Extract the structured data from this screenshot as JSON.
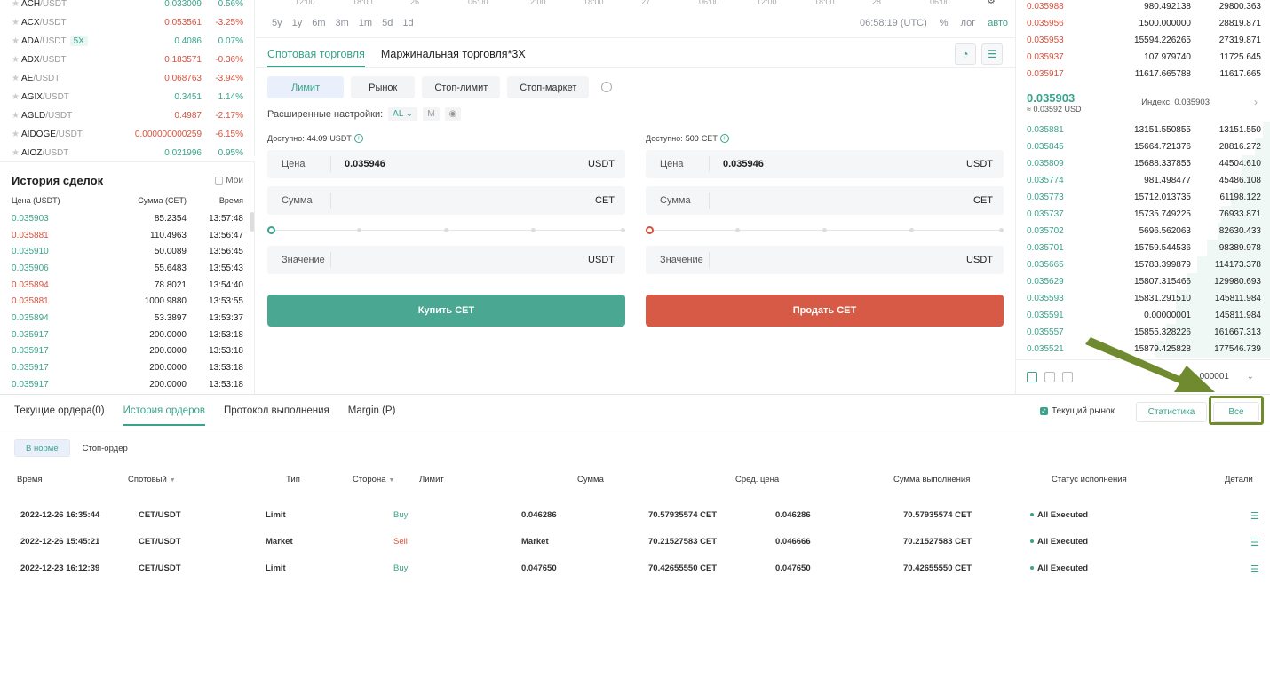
{
  "markets": [
    {
      "base": "ACH",
      "quote": "/USDT",
      "price": "0.033009",
      "change": "0.56%",
      "dir": "up",
      "lev": ""
    },
    {
      "base": "ACX",
      "quote": "/USDT",
      "price": "0.053561",
      "change": "-3.25%",
      "dir": "down",
      "lev": ""
    },
    {
      "base": "ADA",
      "quote": "/USDT",
      "price": "0.4086",
      "change": "0.07%",
      "dir": "up",
      "lev": "5X"
    },
    {
      "base": "ADX",
      "quote": "/USDT",
      "price": "0.183571",
      "change": "-0.36%",
      "dir": "down",
      "lev": ""
    },
    {
      "base": "AE",
      "quote": "/USDT",
      "price": "0.068763",
      "change": "-3.94%",
      "dir": "down",
      "lev": ""
    },
    {
      "base": "AGIX",
      "quote": "/USDT",
      "price": "0.3451",
      "change": "1.14%",
      "dir": "up",
      "lev": ""
    },
    {
      "base": "AGLD",
      "quote": "/USDT",
      "price": "0.4987",
      "change": "-2.17%",
      "dir": "down",
      "lev": ""
    },
    {
      "base": "AIDOGE",
      "quote": "/USDT",
      "price": "0.000000000259",
      "change": "-6.15%",
      "dir": "down",
      "lev": ""
    },
    {
      "base": "AIOZ",
      "quote": "/USDT",
      "price": "0.021996",
      "change": "0.95%",
      "dir": "up",
      "lev": ""
    }
  ],
  "trade_history": {
    "title": "История сделок",
    "mine_label": "Мои",
    "col_price": "Цена (USDT)",
    "col_amount": "Сумма (CET)",
    "col_time": "Время",
    "rows": [
      {
        "price": "0.035903",
        "amount": "85.2354",
        "time": "13:57:48",
        "dir": "up"
      },
      {
        "price": "0.035881",
        "amount": "110.4963",
        "time": "13:56:47",
        "dir": "down"
      },
      {
        "price": "0.035910",
        "amount": "50.0089",
        "time": "13:56:45",
        "dir": "up"
      },
      {
        "price": "0.035906",
        "amount": "55.6483",
        "time": "13:55:43",
        "dir": "up"
      },
      {
        "price": "0.035894",
        "amount": "78.8021",
        "time": "13:54:40",
        "dir": "down"
      },
      {
        "price": "0.035881",
        "amount": "1000.9880",
        "time": "13:53:55",
        "dir": "down"
      },
      {
        "price": "0.035894",
        "amount": "53.3897",
        "time": "13:53:37",
        "dir": "up"
      },
      {
        "price": "0.035917",
        "amount": "200.0000",
        "time": "13:53:18",
        "dir": "up"
      },
      {
        "price": "0.035917",
        "amount": "200.0000",
        "time": "13:53:18",
        "dir": "up"
      },
      {
        "price": "0.035917",
        "amount": "200.0000",
        "time": "13:53:18",
        "dir": "up"
      },
      {
        "price": "0.035917",
        "amount": "200.0000",
        "time": "13:53:18",
        "dir": "up"
      }
    ]
  },
  "chart": {
    "axis_labels": [
      "12:00",
      "18:00",
      "26",
      "06:00",
      "12:00",
      "18:00",
      "27",
      "06:00",
      "12:00",
      "18:00",
      "28",
      "06:00"
    ],
    "timeframes": [
      "5y",
      "1y",
      "6m",
      "3m",
      "1m",
      "5d",
      "1d"
    ],
    "clock": "06:58:19 (UTC)",
    "percent": "%",
    "log": "лог",
    "auto": "авто"
  },
  "trade": {
    "tab_spot": "Спотовая торговля",
    "tab_margin": "Маржинальная торговля*3X",
    "order_types": [
      "Лимит",
      "Рынок",
      "Стоп-лимит",
      "Стоп-маркет"
    ],
    "advanced_label": "Расширенные настройки:",
    "adv_opt1": "AL",
    "adv_opt2": "M",
    "buy": {
      "available_label": "Доступно:",
      "available_value": "44.09",
      "available_unit": "USDT",
      "price_label": "Цена",
      "price_value": "0.035946",
      "price_unit": "USDT",
      "amount_label": "Сумма",
      "amount_unit": "CET",
      "total_label": "Значение",
      "total_unit": "USDT",
      "button": "Купить CET"
    },
    "sell": {
      "available_label": "Доступно:",
      "available_value": "500",
      "available_unit": "CET",
      "price_label": "Цена",
      "price_value": "0.035946",
      "price_unit": "USDT",
      "amount_label": "Сумма",
      "amount_unit": "CET",
      "total_label": "Значение",
      "total_unit": "USDT",
      "button": "Продать CET"
    }
  },
  "orderbook": {
    "asks": [
      {
        "price": "0.035988",
        "amount": "980.492138",
        "total": "29800.363"
      },
      {
        "price": "0.035956",
        "amount": "1500.000000",
        "total": "28819.871"
      },
      {
        "price": "0.035953",
        "amount": "15594.226265",
        "total": "27319.871"
      },
      {
        "price": "0.035937",
        "amount": "107.979740",
        "total": "11725.645"
      },
      {
        "price": "0.035917",
        "amount": "11617.665788",
        "total": "11617.665"
      }
    ],
    "mid_price": "0.035903",
    "mid_usd": "≈ 0.03592 USD",
    "index_label": "Индекс: 0.035903",
    "bids": [
      {
        "price": "0.035881",
        "amount": "13151.550855",
        "total": "13151.550",
        "depth": 0.06
      },
      {
        "price": "0.035845",
        "amount": "15664.721376",
        "total": "28816.272",
        "depth": 0.13
      },
      {
        "price": "0.035809",
        "amount": "15688.337855",
        "total": "44504.610",
        "depth": 0.25
      },
      {
        "price": "0.035774",
        "amount": "981.498477",
        "total": "45486.108",
        "depth": 0.26
      },
      {
        "price": "0.035773",
        "amount": "15712.013735",
        "total": "61198.122",
        "depth": 0.34
      },
      {
        "price": "0.035737",
        "amount": "15735.749225",
        "total": "76933.871",
        "depth": 0.43
      },
      {
        "price": "0.035702",
        "amount": "5696.562063",
        "total": "82630.433",
        "depth": 0.46
      },
      {
        "price": "0.035701",
        "amount": "15759.544536",
        "total": "98389.978",
        "depth": 0.55
      },
      {
        "price": "0.035665",
        "amount": "15783.399879",
        "total": "114173.378",
        "depth": 0.64
      },
      {
        "price": "0.035629",
        "amount": "15807.315466",
        "total": "129980.693",
        "depth": 0.73
      },
      {
        "price": "0.035593",
        "amount": "15831.291510",
        "total": "145811.984",
        "depth": 0.82
      },
      {
        "price": "0.035591",
        "amount": "0.00000001",
        "total": "145811.984",
        "depth": 0.82
      },
      {
        "price": "0.035557",
        "amount": "15855.328226",
        "total": "161667.313",
        "depth": 0.91
      },
      {
        "price": "0.035521",
        "amount": "15879.425828",
        "total": "177546.739",
        "depth": 1.0
      }
    ],
    "precision": "000001"
  },
  "orders": {
    "tabs": [
      "Текущие ордера(0)",
      "История ордеров",
      "Протокол выполнения",
      "Margin (P)"
    ],
    "current_market": "Текущий рынок",
    "stats_button": "Статистика",
    "all_button": "Все",
    "subtabs": [
      "В норме",
      "Стоп-ордер"
    ],
    "columns": [
      "Время",
      "Спотовый",
      "Тип",
      "Сторона",
      "Лимит",
      "Сумма",
      "Сред. цена",
      "Сумма выполнения",
      "Статус исполнения",
      "Детали"
    ],
    "rows": [
      {
        "time": "2022-12-26 16:35:44",
        "pair": "CET/USDT",
        "type": "Limit",
        "side": "Buy",
        "limit": "0.046286",
        "amount": "70.57935574 CET",
        "avg": "0.046286",
        "filled": "70.57935574 CET",
        "status": "All Executed"
      },
      {
        "time": "2022-12-26 15:45:21",
        "pair": "CET/USDT",
        "type": "Market",
        "side": "Sell",
        "limit": "Market",
        "amount": "70.21527583 CET",
        "avg": "0.046666",
        "filled": "70.21527583 CET",
        "status": "All Executed"
      },
      {
        "time": "2022-12-23 16:12:39",
        "pair": "CET/USDT",
        "type": "Limit",
        "side": "Buy",
        "limit": "0.047650",
        "amount": "70.42655550 CET",
        "avg": "0.047650",
        "filled": "70.42655550 CET",
        "status": "All Executed"
      }
    ]
  },
  "colors": {
    "green": "#3aa38b",
    "red": "#d9513e",
    "arrow": "#6f8a2f"
  }
}
